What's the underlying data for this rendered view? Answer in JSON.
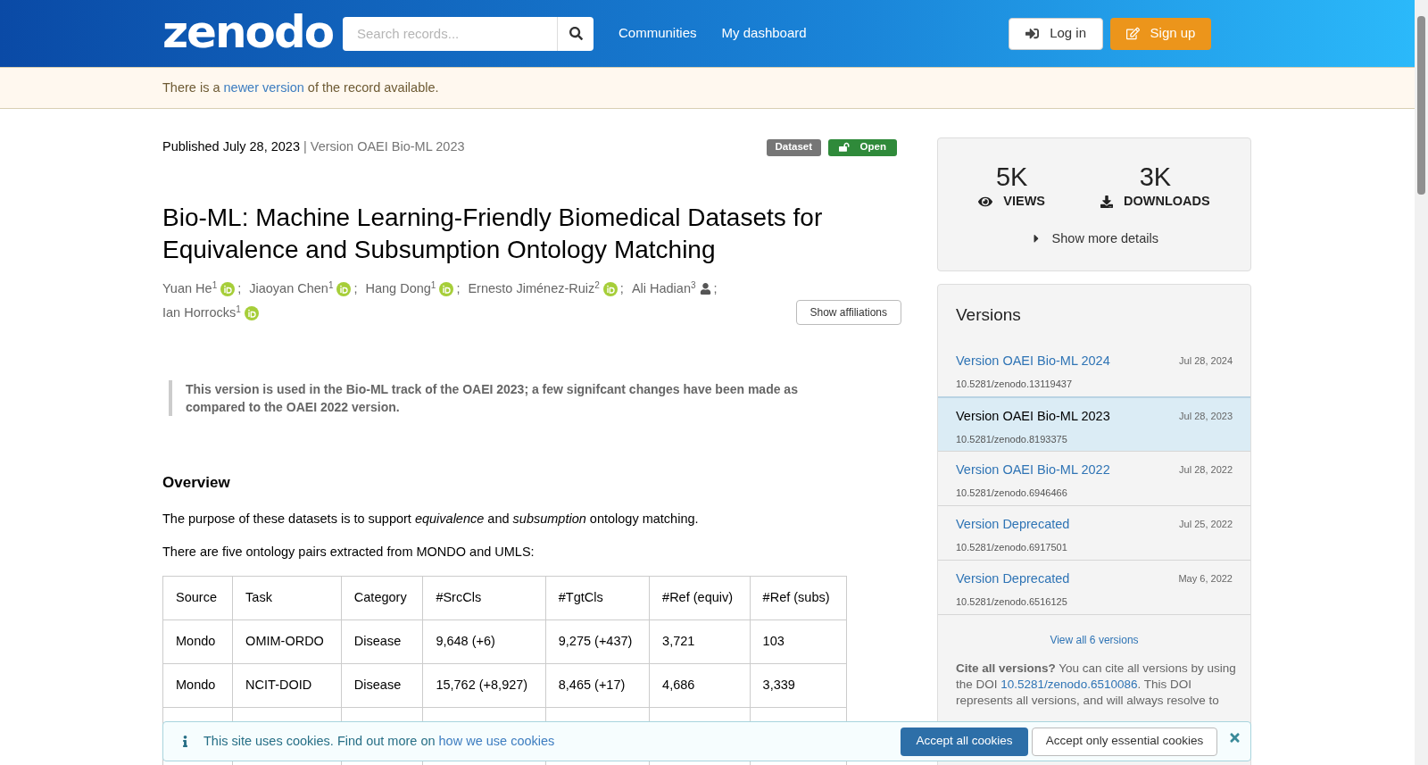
{
  "header": {
    "logo": "zenodo",
    "search": {
      "placeholder": "Search records..."
    },
    "nav": [
      "Communities",
      "My dashboard"
    ],
    "login": "Log in",
    "signup": "Sign up"
  },
  "notice": {
    "before": "There is a",
    "link": "newer version",
    "after": "of the record available."
  },
  "record": {
    "published": "Published July 28, 2023",
    "separator": "|",
    "version": "Version OAEI Bio-ML 2023",
    "badges": [
      {
        "label": "Dataset",
        "kind": "type"
      },
      {
        "label": "Open",
        "kind": "access"
      }
    ],
    "title": "Bio-ML: Machine Learning-Friendly Biomedical Datasets for Equivalence and Subsumption Ontology Matching",
    "authors": [
      {
        "name": "Yuan He",
        "affiliation": "1",
        "kind": "orcid",
        "separator": ";"
      },
      {
        "name": "Jiaoyan Chen",
        "affiliation": "1",
        "kind": "orcid",
        "separator": ";"
      },
      {
        "name": "Hang Dong",
        "affiliation": "1",
        "kind": "orcid",
        "separator": ";"
      },
      {
        "name": "Ernesto Jiménez-Ruiz",
        "affiliation": "2",
        "kind": "orcid",
        "separator": ";"
      },
      {
        "name": "Ali Hadian",
        "affiliation": "3",
        "kind": "person",
        "separator": ";"
      },
      {
        "name": "Ian Horrocks",
        "affiliation": "1",
        "kind": "orcid"
      }
    ],
    "show_affiliations": "Show affiliations",
    "quote": "This version is used in the Bio-ML track of the OAEI 2023; a few signifcant changes have been made as compared to the OAEI 2022 version.",
    "overview": {
      "heading": "Overview",
      "paragraphs": [
        "The purpose of these datasets is to support *equivalence* and *subsumption* ontology matching.",
        "There are five ontology pairs extracted from MONDO and UMLS:"
      ]
    },
    "table": {
      "columns": [
        "Source",
        "Task",
        "Category",
        "#SrcCls",
        "#TgtCls",
        "#Ref (equiv)",
        "#Ref (subs)"
      ],
      "rows": [
        [
          "Mondo",
          "OMIM-ORDO",
          "Disease",
          "9,648 (+6)",
          "9,275 (+437)",
          "3,721",
          "103"
        ],
        [
          "Mondo",
          "NCIT-DOID",
          "Disease",
          "15,762 (+8,927)",
          "8,465 (+17)",
          "4,686",
          "3,339"
        ]
      ]
    }
  },
  "stats": {
    "items": [
      {
        "value": "5K",
        "label": "VIEWS",
        "kind": "views"
      },
      {
        "value": "3K",
        "label": "DOWNLOADS",
        "kind": "downloads"
      }
    ],
    "show_more": "Show more details"
  },
  "versions": {
    "title": "Versions",
    "items": [
      {
        "title": "Version OAEI Bio-ML 2024",
        "date": "Jul 28, 2024",
        "doi": "10.5281/zenodo.13119437",
        "selected": false
      },
      {
        "title": "Version OAEI Bio-ML 2023",
        "date": "Jul 28, 2023",
        "doi": "10.5281/zenodo.8193375",
        "selected": true
      },
      {
        "title": "Version OAEI Bio-ML 2022",
        "date": "Jul 28, 2022",
        "doi": "10.5281/zenodo.6946466",
        "selected": false
      },
      {
        "title": "Version Deprecated",
        "date": "Jul 25, 2022",
        "doi": "10.5281/zenodo.6917501",
        "selected": false
      },
      {
        "title": "Version Deprecated",
        "date": "May 6, 2022",
        "doi": "10.5281/zenodo.6516125",
        "selected": false
      }
    ],
    "view_all": "View all 6 versions",
    "cite_before": "**Cite all versions?** You can cite all versions by using the DOI",
    "cite_link": "10.5281/zenodo.6510086",
    "cite_after": ". This DOI represents all versions, and will always resolve to"
  },
  "cookies": {
    "text": "This site uses cookies. Find out more on",
    "link": "how we use cookies",
    "accept_all": "Accept all cookies",
    "accept_essential": "Accept only essential cookies"
  }
}
